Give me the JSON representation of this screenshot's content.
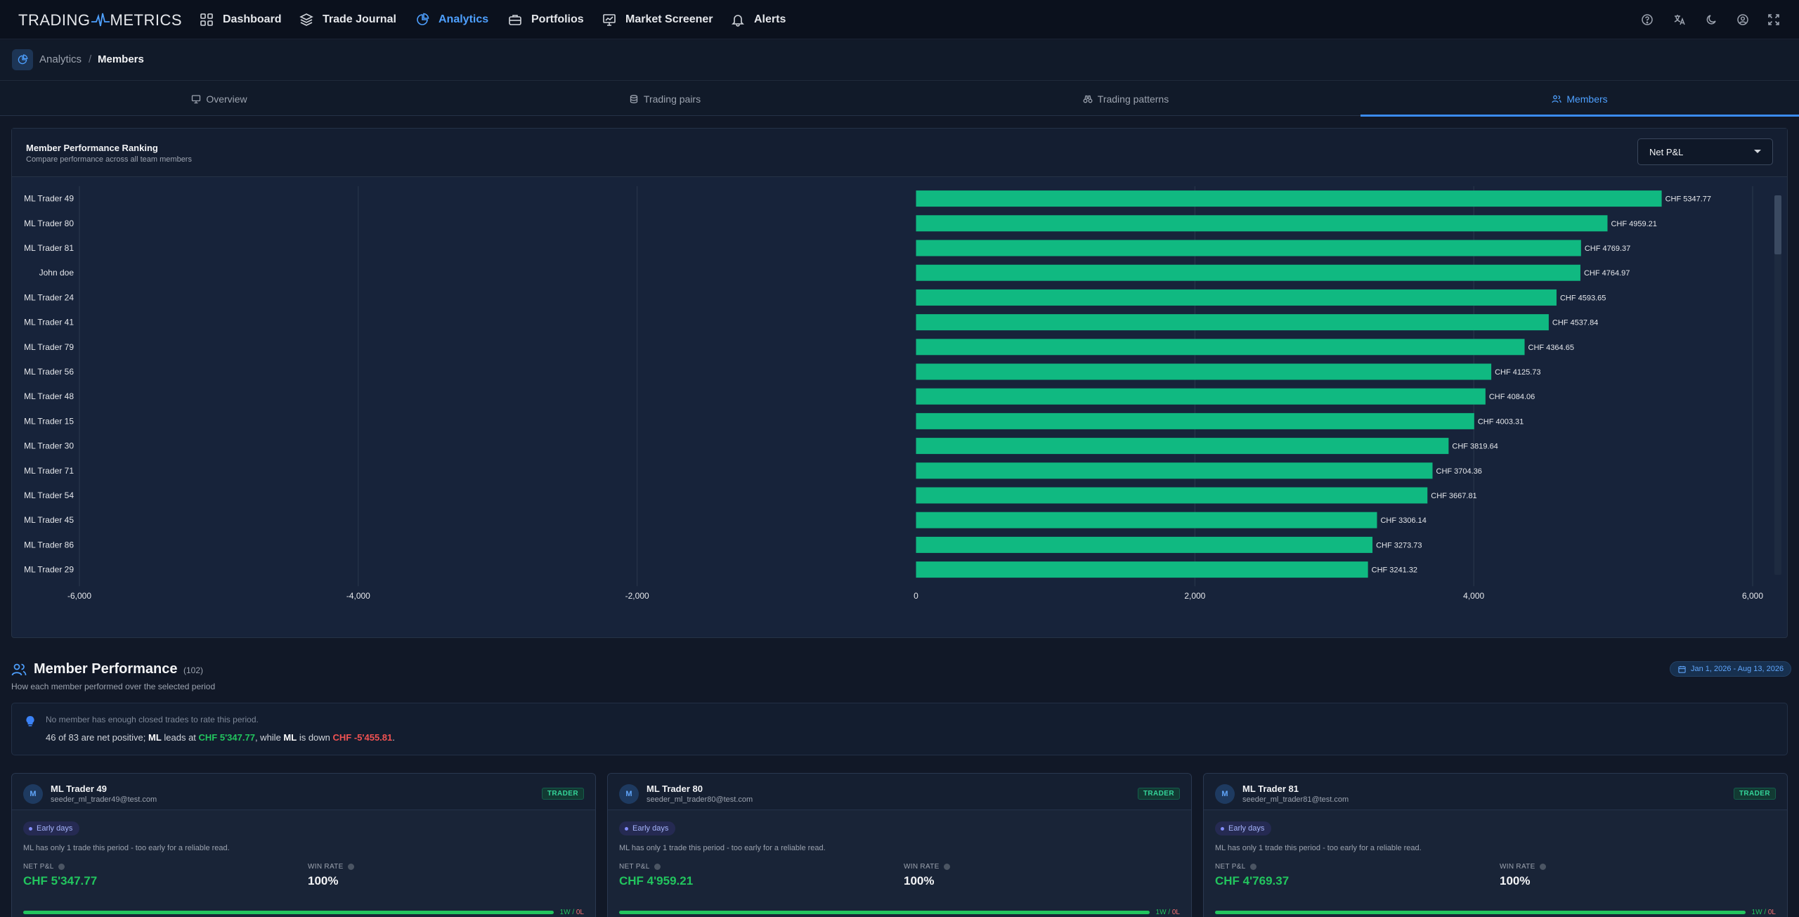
{
  "app": {
    "logo_left": "TRADING",
    "logo_right": "METRICS"
  },
  "nav": {
    "items": [
      {
        "label": "Dashboard",
        "icon": "grid-icon",
        "active": false
      },
      {
        "label": "Trade Journal",
        "icon": "layers-icon",
        "active": false
      },
      {
        "label": "Analytics",
        "icon": "pie-chart-icon",
        "active": true
      },
      {
        "label": "Portfolios",
        "icon": "briefcase-icon",
        "active": false
      },
      {
        "label": "Market Screener",
        "icon": "presentation-chart-icon",
        "active": false
      },
      {
        "label": "Alerts",
        "icon": "bell-icon",
        "active": false
      }
    ],
    "right_icons": [
      "help-icon",
      "translate-icon",
      "moon-icon",
      "user-circle-icon",
      "fullscreen-icon"
    ]
  },
  "breadcrumb": {
    "parent": "Analytics",
    "separator": "/",
    "current": "Members"
  },
  "tabs": [
    {
      "label": "Overview",
      "icon": "presentation-icon",
      "active": false
    },
    {
      "label": "Trading pairs",
      "icon": "coins-icon",
      "active": false
    },
    {
      "label": "Trading patterns",
      "icon": "binoculars-icon",
      "active": false
    },
    {
      "label": "Members",
      "icon": "users-icon",
      "active": true
    }
  ],
  "ranking": {
    "title": "Member Performance Ranking",
    "subtitle": "Compare performance across all team members",
    "metric_selected": "Net P&L"
  },
  "chart_data": {
    "type": "bar",
    "orientation": "horizontal",
    "title": "Member Performance Ranking",
    "xlim": [
      -6000,
      6000
    ],
    "x_ticks": [
      "-6,000",
      "-4,000",
      "-2,000",
      "0",
      "2,000",
      "4,000",
      "6,000"
    ],
    "x_tick_values": [
      -6000,
      -4000,
      -2000,
      0,
      2000,
      4000,
      6000
    ],
    "grid": true,
    "bar_color": "#10b981",
    "categories": [
      "ML Trader 49",
      "ML Trader 80",
      "ML Trader 81",
      "John doe",
      "ML Trader 24",
      "ML Trader 41",
      "ML Trader 79",
      "ML Trader 56",
      "ML Trader 48",
      "ML Trader 15",
      "ML Trader 30",
      "ML Trader 71",
      "ML Trader 54",
      "ML Trader 45",
      "ML Trader 86",
      "ML Trader 29"
    ],
    "values": [
      5347.77,
      4959.21,
      4769.37,
      4764.97,
      4593.65,
      4537.84,
      4364.65,
      4125.73,
      4084.06,
      4003.31,
      3819.64,
      3704.36,
      3667.81,
      3306.14,
      3273.73,
      3241.32
    ],
    "value_labels": [
      "CHF 5347.77",
      "CHF 4959.21",
      "CHF 4769.37",
      "CHF 4764.97",
      "CHF 4593.65",
      "CHF 4537.84",
      "CHF 4364.65",
      "CHF 4125.73",
      "CHF 4084.06",
      "CHF 4003.31",
      "CHF 3819.64",
      "CHF 3704.36",
      "CHF 3667.81",
      "CHF 3306.14",
      "CHF 3273.73",
      "CHF 3241.32"
    ]
  },
  "member_performance": {
    "title": "Member Performance",
    "count": "(102)",
    "subtitle": "How each member performed over the selected period",
    "date_range": "Jan 1, 2026 - Aug 13, 2026"
  },
  "insight": {
    "line1": "No member has enough closed trades to rate this period.",
    "line2_prefix": "46 of 83 are net positive; ",
    "leader": "ML",
    "leads_at": " leads at ",
    "leader_value": "CHF 5'347.77",
    "while": ", while ",
    "laggard": "ML",
    "is_down": " is down ",
    "laggard_value": "CHF -5'455.81",
    "end": "."
  },
  "cards": [
    {
      "avatar": "M",
      "name": "ML Trader 49",
      "email": "seeder_ml_trader49@test.com",
      "role": "TRADER",
      "badge": "Early days",
      "note": "ML has only 1 trade this period - too early for a reliable read.",
      "pnl_label": "NET P&L",
      "pnl": "CHF 5'347.77",
      "wr_label": "WIN RATE",
      "win_rate": "100%",
      "win_fraction": 1.0,
      "wins": "1W",
      "sep": "/",
      "losses": "0L"
    },
    {
      "avatar": "M",
      "name": "ML Trader 80",
      "email": "seeder_ml_trader80@test.com",
      "role": "TRADER",
      "badge": "Early days",
      "note": "ML has only 1 trade this period - too early for a reliable read.",
      "pnl_label": "NET P&L",
      "pnl": "CHF 4'959.21",
      "wr_label": "WIN RATE",
      "win_rate": "100%",
      "win_fraction": 1.0,
      "wins": "1W",
      "sep": "/",
      "losses": "0L"
    },
    {
      "avatar": "M",
      "name": "ML Trader 81",
      "email": "seeder_ml_trader81@test.com",
      "role": "TRADER",
      "badge": "Early days",
      "note": "ML has only 1 trade this period - too early for a reliable read.",
      "pnl_label": "NET P&L",
      "pnl": "CHF 4'769.37",
      "wr_label": "WIN RATE",
      "win_rate": "100%",
      "win_fraction": 1.0,
      "wins": "1W",
      "sep": "/",
      "losses": "0L"
    }
  ]
}
